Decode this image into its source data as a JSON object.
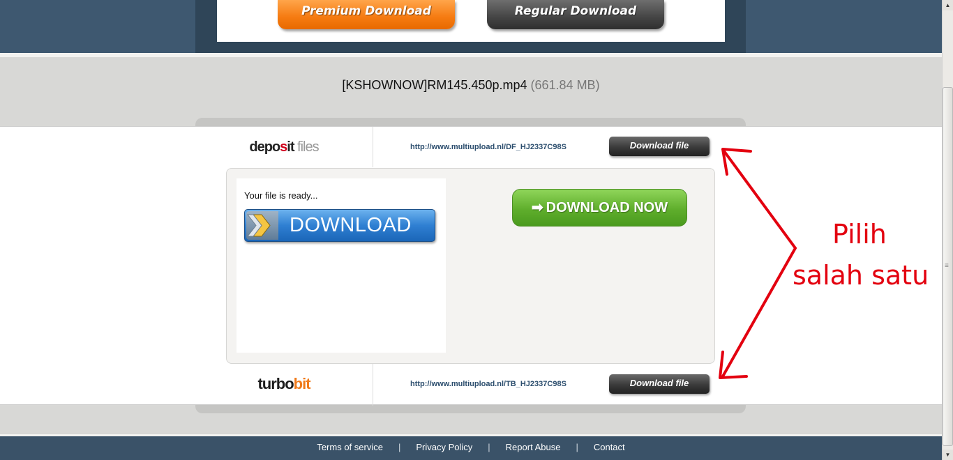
{
  "top_banner": {
    "premium_label": "Premium Download",
    "regular_label": "Regular Download"
  },
  "file": {
    "name": "[KSHOWNOW]RM145.450p.mp4",
    "size": "(661.84 MB)"
  },
  "hosts": [
    {
      "logo_main": "depo",
      "logo_o": "s",
      "logo_rest": "it",
      "logo_suffix": " files",
      "url": "http://www.multiupload.nl/DF_HJ2337C98S",
      "button_label": "Download file"
    },
    {
      "logo_main": "turbo",
      "logo_suffix": "bit",
      "url": "http://www.multiupload.nl/TB_HJ2337C98S",
      "button_label": "Download file"
    }
  ],
  "ad": {
    "ready_text": "Your file is ready...",
    "download_label": "DOWNLOAD",
    "download_now_label": "DOWNLOAD NOW"
  },
  "annotation": {
    "line1": "Pilih",
    "line2": "salah satu",
    "color": "#e3000f"
  },
  "footer": {
    "links": [
      "Terms of service",
      "Privacy Policy",
      "Report Abuse",
      "Contact"
    ]
  },
  "colors": {
    "header_bg": "#3e5870",
    "premium": "#f57a10",
    "regular": "#444444",
    "download_now": "#5fae2c",
    "download_blue": "#2f7fd2"
  }
}
